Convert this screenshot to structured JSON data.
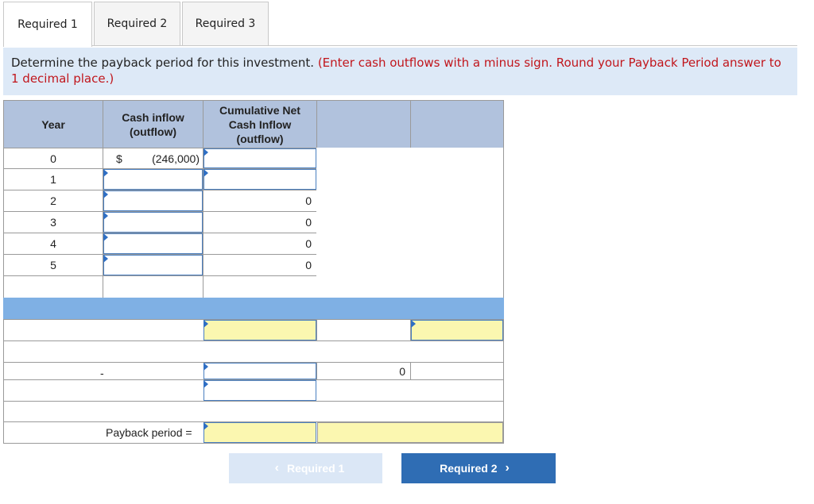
{
  "tabs": [
    {
      "label": "Required 1",
      "active": true
    },
    {
      "label": "Required 2",
      "active": false
    },
    {
      "label": "Required 3",
      "active": false
    }
  ],
  "instruction": {
    "main": "Determine the payback period for this investment.",
    "hint": "(Enter cash outflows with a minus sign. Round your Payback Period answer to 1 decimal place.)"
  },
  "table": {
    "headers": {
      "year": "Year",
      "cash_inflow": "Cash inflow (outflow)",
      "cumulative": "Cumulative Net Cash Inflow (outflow)",
      "blank1": "",
      "blank2": ""
    },
    "rows": [
      {
        "year": "0",
        "currency": "$",
        "cash": "(246,000)",
        "cumulative": ""
      },
      {
        "year": "1",
        "currency": "",
        "cash": "",
        "cumulative": ""
      },
      {
        "year": "2",
        "currency": "",
        "cash": "",
        "cumulative": "0"
      },
      {
        "year": "3",
        "currency": "",
        "cash": "",
        "cumulative": "0"
      },
      {
        "year": "4",
        "currency": "",
        "cash": "",
        "cumulative": "0"
      },
      {
        "year": "5",
        "currency": "",
        "cash": "",
        "cumulative": "0"
      }
    ],
    "calc": {
      "dash": "-",
      "zero": "0",
      "payback_label": "Payback period ="
    },
    "colors": {
      "header": "#b1c2dd",
      "band": "#7fb0e4",
      "answer": "#fbf7b0",
      "input_border": "#4a7fc0"
    }
  },
  "nav": {
    "prev_label": "Required 1",
    "next_label": "Required 2",
    "prev_icon": "chevron-left-icon",
    "next_icon": "chevron-right-icon"
  }
}
